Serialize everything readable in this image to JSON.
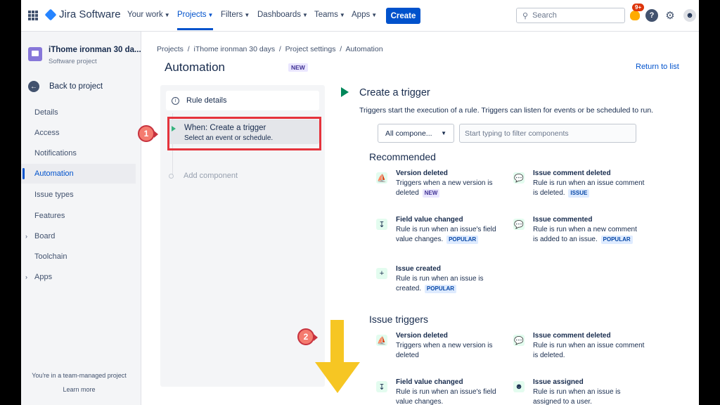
{
  "topnav": {
    "logo_text": "Jira Software",
    "items": [
      "Your work",
      "Projects",
      "Filters",
      "Dashboards",
      "Teams",
      "Apps"
    ],
    "create_label": "Create",
    "search_placeholder": "Search",
    "notification_badge": "9+"
  },
  "sidebar": {
    "project_name": "iThome ironman 30 da...",
    "project_type": "Software project",
    "back_label": "Back to project",
    "items": [
      "Details",
      "Access",
      "Notifications",
      "Automation",
      "Issue types",
      "Features",
      "Board",
      "Toolchain",
      "Apps"
    ],
    "active_item": "Automation",
    "footer_text": "You're in a team-managed project",
    "learn_more": "Learn more"
  },
  "main": {
    "breadcrumb": "Projects  /  iThome ironman 30 days  /  Project settings  /  Automation",
    "title": "Automation",
    "title_badge": "NEW",
    "return_link": "Return to list",
    "rule_details": "Rule details",
    "trigger_title": "When: Create a trigger",
    "trigger_subtitle": "Select an event or schedule.",
    "add_component": "Add component"
  },
  "annotations": {
    "step1": "1",
    "step2": "2"
  },
  "trigger_panel": {
    "heading": "Create a trigger",
    "description": "Triggers start the execution of a rule. Triggers can listen for events or be scheduled to run.",
    "select_value": "All compone...",
    "filter_placeholder": "Start typing to filter components",
    "recommended_title": "Recommended",
    "issue_triggers_title": "Issue triggers",
    "recommended": [
      {
        "title": "Version deleted",
        "desc": "Triggers when a new version is deleted",
        "lozenge": "NEW",
        "icon": "ship-icon"
      },
      {
        "title": "Issue comment deleted",
        "desc": "Rule is run when an issue comment is deleted.",
        "lozenge": "ISSUE",
        "icon": "comment-icon"
      },
      {
        "title": "Field value changed",
        "desc": "Rule is run when an issue's field value changes.",
        "lozenge": "POPULAR",
        "icon": "field-icon"
      },
      {
        "title": "Issue commented",
        "desc": "Rule is run when a new comment is added to an issue.",
        "lozenge": "POPULAR",
        "icon": "comment-icon"
      },
      {
        "title": "Issue created",
        "desc": "Rule is run when an issue is created.",
        "lozenge": "POPULAR",
        "icon": "plus-icon"
      }
    ],
    "issue_triggers": [
      {
        "title": "Version deleted",
        "desc": "Triggers when a new version is deleted",
        "icon": "ship-icon"
      },
      {
        "title": "Issue comment deleted",
        "desc": "Rule is run when an issue comment is deleted.",
        "icon": "comment-icon"
      },
      {
        "title": "Field value changed",
        "desc": "Rule is run when an issue's field value changes.",
        "icon": "field-icon"
      },
      {
        "title": "Issue assigned",
        "desc": "Rule is run when an issue is assigned to a user.",
        "icon": "user-icon"
      }
    ]
  }
}
